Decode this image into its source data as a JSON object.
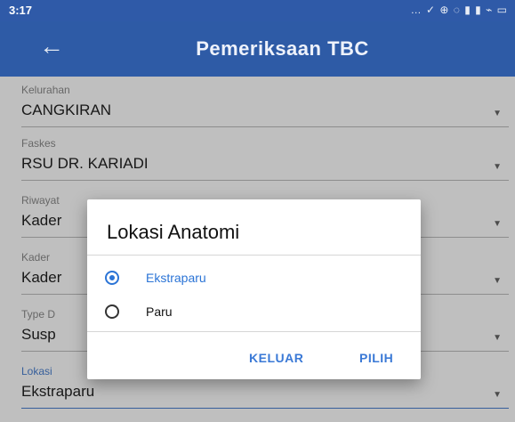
{
  "status": {
    "time": "3:17",
    "icons": "… ✓ ⊕ ◌ ▮ ▮ ⌁ ▭"
  },
  "appbar": {
    "back_icon": "arrow-left-icon",
    "title": "Pemeriksaan TBC"
  },
  "fields": [
    {
      "label": "Kelurahan",
      "value": "CANGKIRAN"
    },
    {
      "label": "Faskes",
      "value": "RSU DR. KARIADI"
    },
    {
      "label": "Riwayat",
      "value": "Kader"
    },
    {
      "label": "Kader",
      "value": "Kader"
    },
    {
      "label": "Type D",
      "value": "Susp"
    },
    {
      "label": "Lokasi",
      "value": "Ekstraparu"
    }
  ],
  "dialog": {
    "title": "Lokasi Anatomi",
    "options": [
      {
        "label": "Ekstraparu",
        "selected": true
      },
      {
        "label": "Paru",
        "selected": false
      }
    ],
    "cancel_label": "KELUAR",
    "ok_label": "PILIH"
  }
}
